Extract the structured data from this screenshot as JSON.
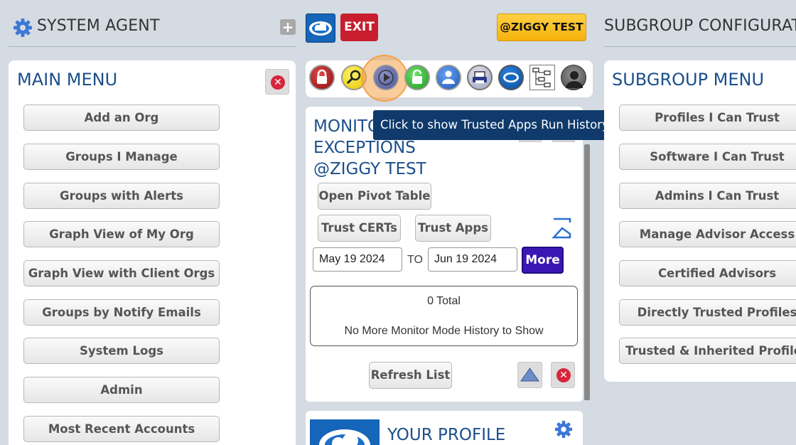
{
  "left_header": {
    "title": "SYSTEM AGENT"
  },
  "center_header": {
    "exit_label": "EXIT",
    "account_label": "@ZIGGY TEST"
  },
  "right_header": {
    "title": "SUBGROUP CONFIGURATIO"
  },
  "main_menu": {
    "title": "MAIN MENU",
    "items": [
      "Add an Org",
      "Groups I Manage",
      "Groups with Alerts",
      "Graph View of My Org",
      "Graph View with Client Orgs",
      "Groups by Notify Emails",
      "System Logs",
      "Admin",
      "Most Recent Accounts"
    ]
  },
  "toolbar": {
    "icons": [
      "lock-red-icon",
      "magnifier-icon",
      "play-icon",
      "lock-green-icon",
      "users-icon",
      "printer-icon",
      "cloud-icon",
      "sitemap-icon",
      "avatar-icon"
    ],
    "tooltip": "Click to show Trusted Apps Run History"
  },
  "monitor": {
    "title_line1": "MONITO",
    "title_line2": "EXCEPTIONS",
    "title_line3": "@ZIGGY TEST",
    "open_pivot_label": "Open Pivot Table",
    "trust_certs_label": "Trust CERTs",
    "trust_apps_label": "Trust Apps",
    "date_from": "May 19 2024",
    "to_label": "TO",
    "date_to": "Jun 19 2024",
    "more_label": "More",
    "total_text": "0 Total",
    "empty_text": "No More Monitor Mode History to Show",
    "refresh_label": "Refresh List"
  },
  "profile": {
    "title": "YOUR PROFILE"
  },
  "subgroup_menu": {
    "title": "SUBGROUP MENU",
    "items": [
      "Profiles I Can Trust",
      "Software I Can Trust",
      "Admins I Can Trust",
      "Manage Advisor Access",
      "Certified Advisors",
      "Directly Trusted Profiles",
      "Trusted & Inherited Profiles"
    ]
  },
  "colors": {
    "background": "#d4dbe2",
    "menu_title": "#1b4f8a",
    "exit_button": "#c81e2e",
    "account_button": "#fbbf18",
    "more_button": "#3a17b5",
    "tooltip": "#0f3a6b",
    "highlight": "#f5a24a"
  }
}
